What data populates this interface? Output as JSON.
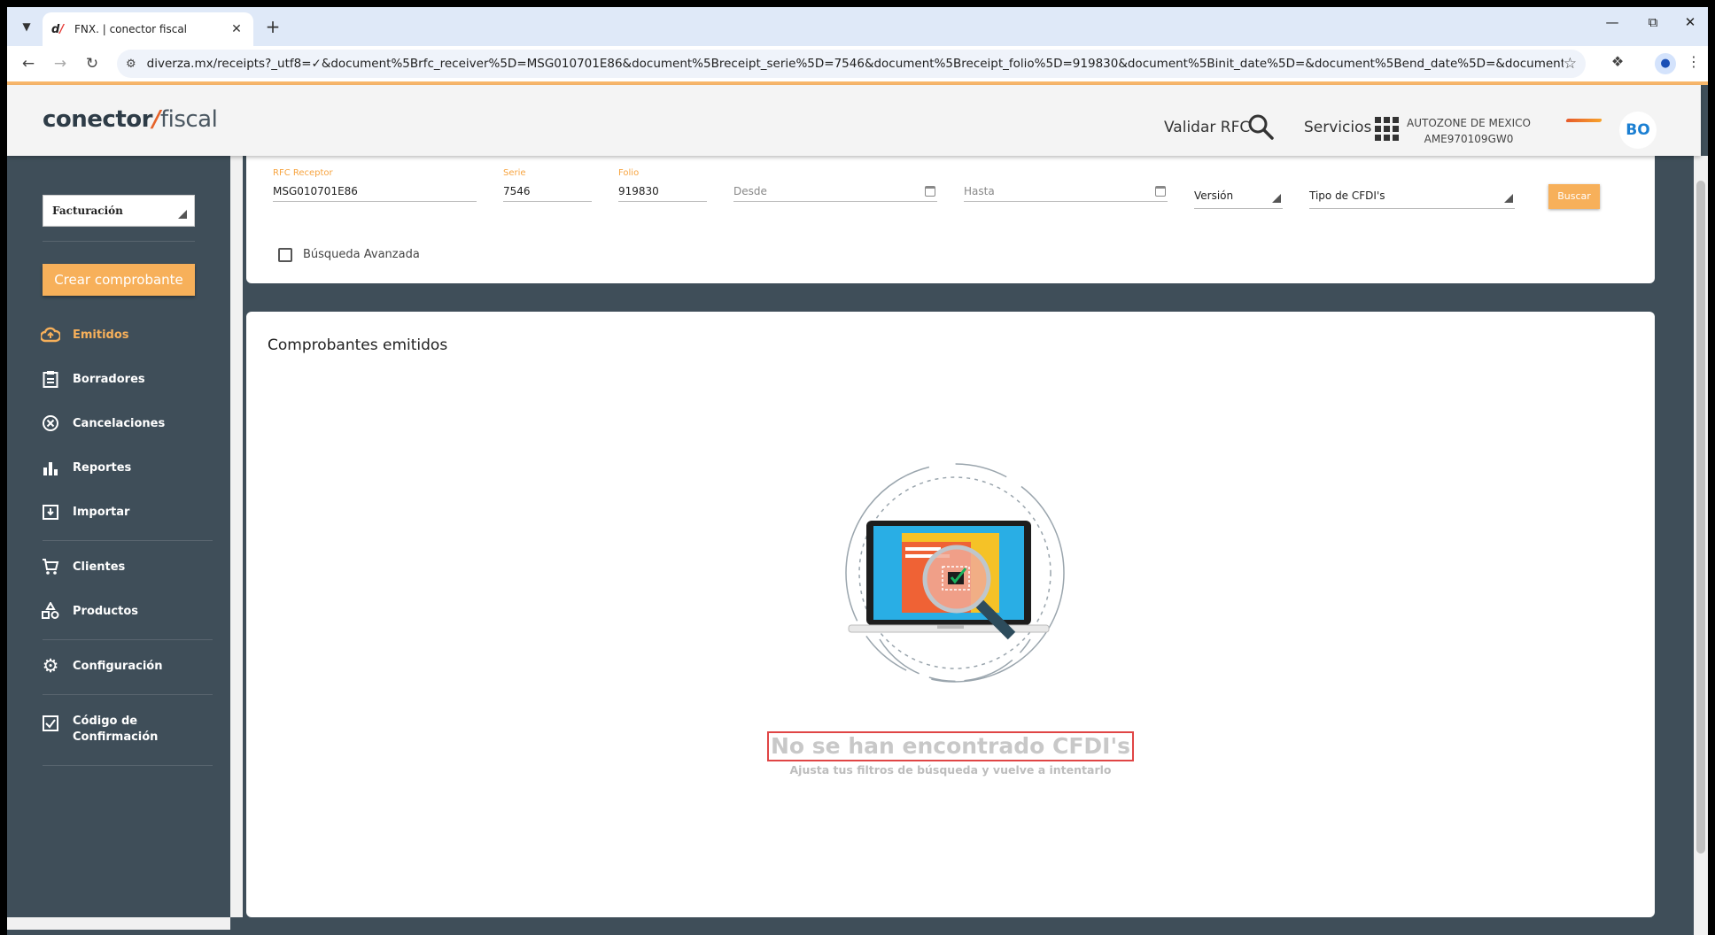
{
  "browser": {
    "tab_title": "FNX. | conector fiscal",
    "favicon_text": "d",
    "url": "diverza.mx/receipts?_utf8=✓&document%5Brfc_receiver%5D=MSG010701E86&document%5Breceipt_serie%5D=7546&document%5Breceipt_folio%5D=919830&document%5Binit_date%5D=&document%5Bend_date%5D=&document%5Bversion%5D=&..."
  },
  "header": {
    "logo_bold": "conector",
    "logo_thin": "fiscal",
    "validate_rfc": "Validar RFC",
    "services": "Servicios",
    "company_name": "AUTOZONE DE MEXICO",
    "company_rfc": "AME970109GW0",
    "user_initials": "BO"
  },
  "sidebar": {
    "module_select": "Facturación",
    "create_button": "Crear comprobante",
    "items": [
      {
        "label": "Emitidos",
        "icon": "cloud-upload-icon"
      },
      {
        "label": "Borradores",
        "icon": "clipboard-icon"
      },
      {
        "label": "Cancelaciones",
        "icon": "cancel-circle-icon"
      },
      {
        "label": "Reportes",
        "icon": "bar-chart-icon"
      },
      {
        "label": "Importar",
        "icon": "import-icon"
      },
      {
        "label": "Clientes",
        "icon": "cart-icon"
      },
      {
        "label": "Productos",
        "icon": "products-icon"
      },
      {
        "label": "Configuración",
        "icon": "gear-icon"
      },
      {
        "label": "Código de",
        "label2": "Confirmación",
        "icon": "checkbox-icon"
      }
    ]
  },
  "filters": {
    "rfc_label": "RFC Receptor",
    "rfc_value": "MSG010701E86",
    "serie_label": "Serie",
    "serie_value": "7546",
    "folio_label": "Folio",
    "folio_value": "919830",
    "desde_placeholder": "Desde",
    "hasta_placeholder": "Hasta",
    "version_label": "Versión",
    "tipo_label": "Tipo de CFDI's",
    "search_button": "Buscar",
    "advanced_search": "Búsqueda Avanzada"
  },
  "results": {
    "title": "Comprobantes emitidos",
    "empty_title": "No se han encontrado CFDI's",
    "empty_subtitle": "Ajusta tus filtros de búsqueda y vuelve a intentarlo"
  },
  "colors": {
    "accent": "#f7b05a",
    "sidebar_bg": "#3f4e59",
    "link_blue": "#1b7fd2"
  }
}
